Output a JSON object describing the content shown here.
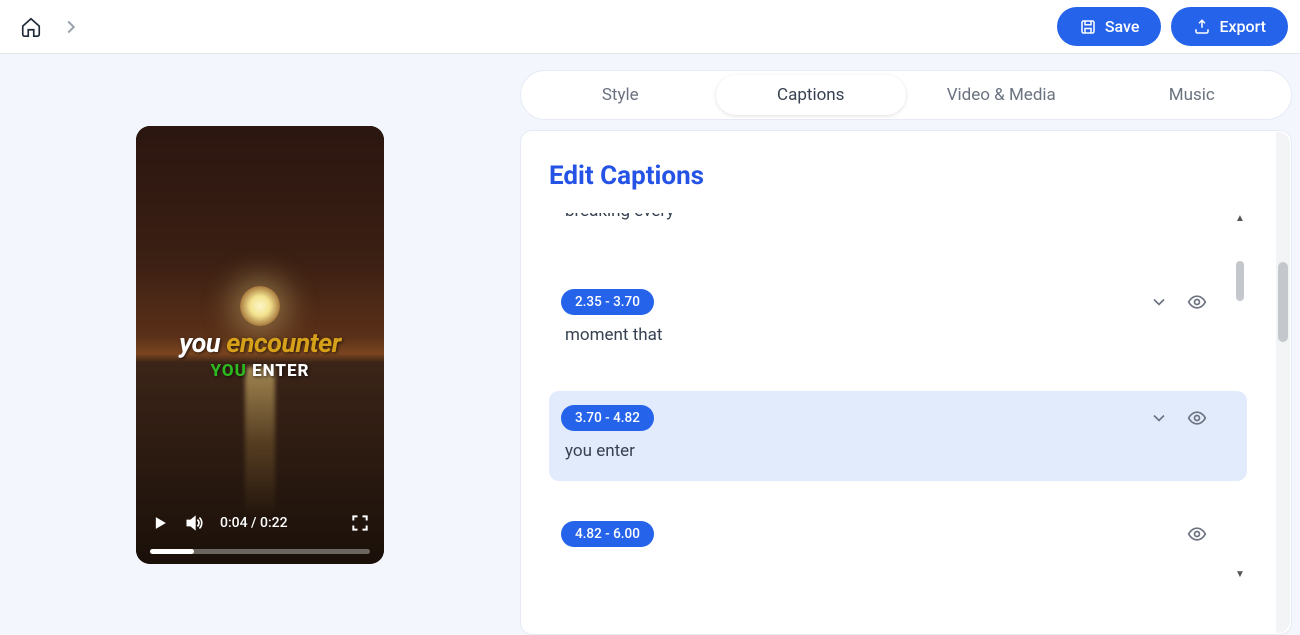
{
  "header": {
    "save_label": "Save",
    "export_label": "Export"
  },
  "tabs": {
    "style": "Style",
    "captions": "Captions",
    "video_media": "Video & Media",
    "music": "Music"
  },
  "panel": {
    "title": "Edit Captions"
  },
  "video": {
    "current_time": "0:04",
    "duration": "0:22",
    "overlay": {
      "line1_a": "you ",
      "line1_b": "encounter",
      "line2_a": "YOU ",
      "line2_b": "ENTER"
    }
  },
  "captions": [
    {
      "start": "",
      "end": "",
      "text": "breaking every"
    },
    {
      "start": "2.35",
      "end": "3.70",
      "text": "moment that"
    },
    {
      "start": "3.70",
      "end": "4.82",
      "text": "you enter"
    },
    {
      "start": "4.82",
      "end": "6.00",
      "text": ""
    }
  ],
  "sep": " / ",
  "dash": "  -  "
}
